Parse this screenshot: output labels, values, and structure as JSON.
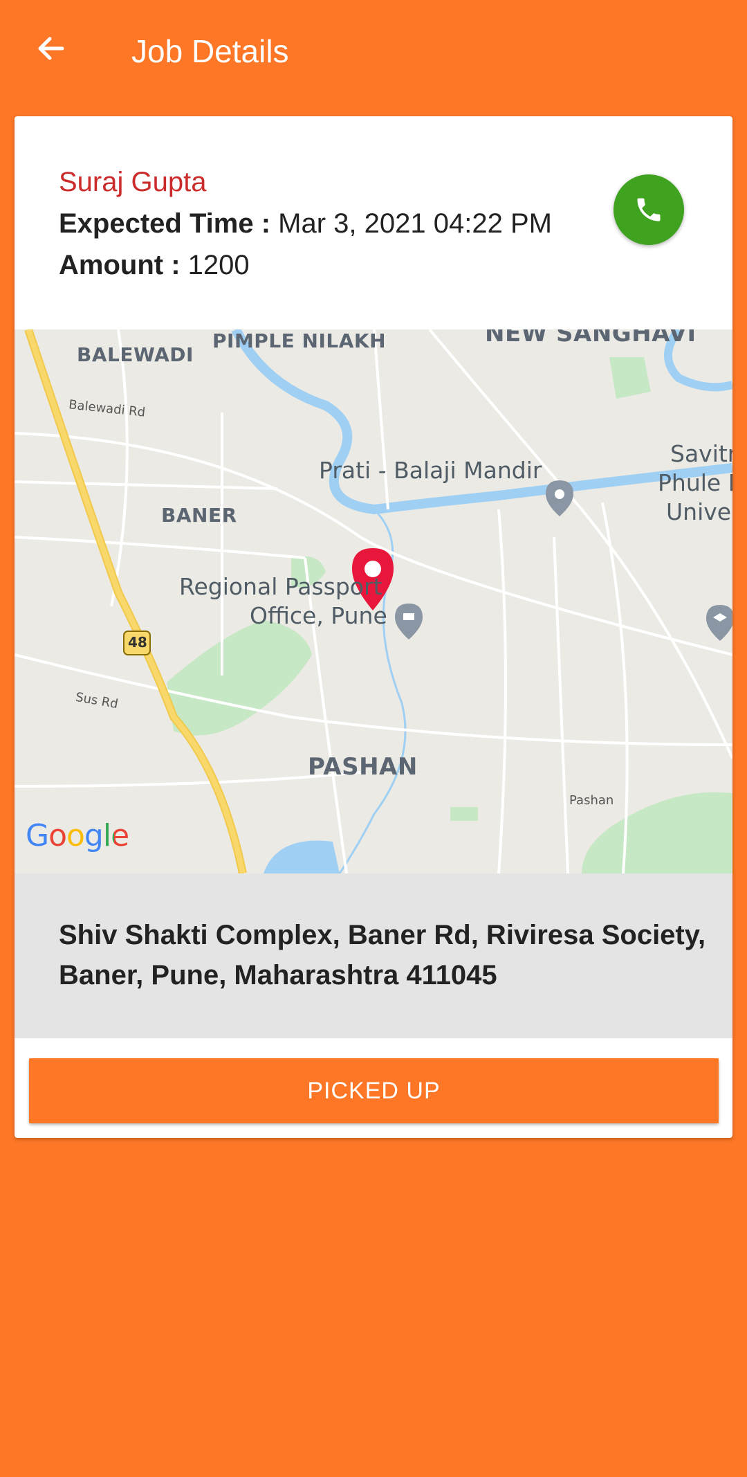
{
  "app_bar": {
    "title": "Job Details",
    "back_icon": "arrow-left-icon"
  },
  "job": {
    "customer_name": "Suraj Gupta",
    "expected_time_label": "Expected Time :",
    "expected_time_value": "Mar 3, 2021 04:22 PM",
    "amount_label": "Amount :",
    "amount_value": "1200",
    "call_icon": "phone-icon"
  },
  "map": {
    "labels": {
      "balewadi": "BALEWADI",
      "pimple_nilakh": "PIMPLE NILAKH",
      "new_sanghavi": "NEW SANGHAVI",
      "balewadi_rd": "Balewadi Rd",
      "prati_balaji": "Prati - Balaji Mandir",
      "savitribai_1": "Savitr",
      "savitribai_2": "Phule P",
      "savitribai_3": "Univer",
      "baner": "BANER",
      "passport_1": "Regional Passport",
      "passport_2": "Office, Pune",
      "highway": "48",
      "sus_rd": "Sus Rd",
      "pashan": "PASHAN",
      "pashan_rd": "Pashan"
    },
    "attribution": "Google",
    "directions_icon": "directions-turn-icon",
    "marker_icon": "map-pin-icon",
    "colors": {
      "marker": "#e8163a",
      "water": "#9fd0f4",
      "park": "#c6e8c4",
      "highway": "#f8d86a"
    }
  },
  "address": "Shiv Shakti Complex, Baner Rd, Riviresa Society, Baner, Pune, Maharashtra 411045",
  "action_button": "PICKED UP",
  "colors": {
    "primary": "#fd7726",
    "name": "#cc2b2b",
    "call_button": "#3fa320",
    "directions_button": "#2196f3"
  }
}
